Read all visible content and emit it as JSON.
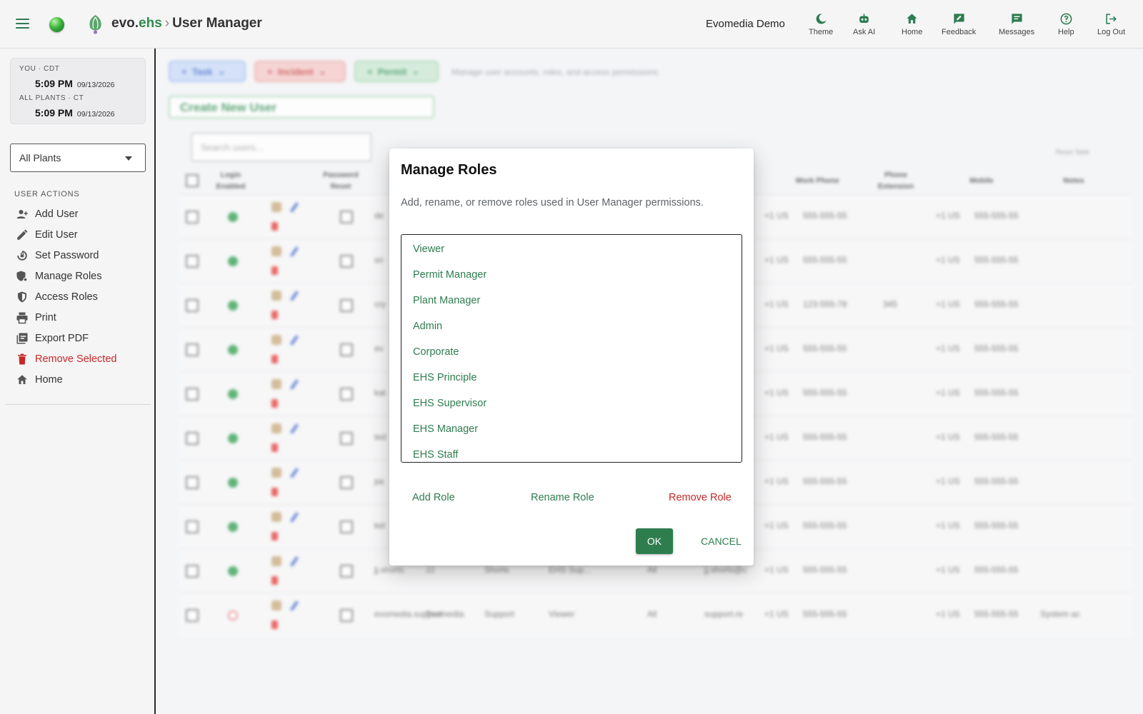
{
  "app": {
    "brand_prefix": "evo.",
    "brand_suffix": "ehs",
    "breadcrumb_sep": "›",
    "page_title": "User Manager",
    "org_name": "Evomedia Demo",
    "accent_color": "#2e7d4f",
    "danger_color": "#c62828"
  },
  "topnav": [
    {
      "label": "Theme",
      "icon": "moon-icon"
    },
    {
      "label": "Ask AI",
      "icon": "robot-icon"
    },
    {
      "label": "Home",
      "icon": "home-icon"
    },
    {
      "label": "Feedback",
      "icon": "feedback-icon"
    },
    {
      "label": "Messages",
      "icon": "message-icon"
    },
    {
      "label": "Help",
      "icon": "help-icon"
    },
    {
      "label": "Log Out",
      "icon": "logout-icon"
    }
  ],
  "clock": {
    "you_label": "YOU · CDT",
    "you_time": "5:09 PM",
    "you_date": "09/13/2026",
    "plants_label": "ALL PLANTS · CT",
    "plants_time": "5:09 PM",
    "plants_date": "09/13/2026"
  },
  "plant_select": {
    "value": "All Plants"
  },
  "sidebar": {
    "heading": "USER ACTIONS",
    "items": [
      {
        "label": "Add User",
        "icon": "add-user-icon"
      },
      {
        "label": "Edit User",
        "icon": "pencil-icon"
      },
      {
        "label": "Set Password",
        "icon": "password-reset-icon"
      },
      {
        "label": "Manage Roles",
        "icon": "manage-roles-icon"
      },
      {
        "label": "Access Roles",
        "icon": "shield-icon"
      },
      {
        "label": "Print",
        "icon": "printer-icon"
      },
      {
        "label": "Export PDF",
        "icon": "pdf-icon"
      },
      {
        "label": "Remove Selected",
        "icon": "trash-icon"
      },
      {
        "label": "Home",
        "icon": "home-icon"
      }
    ]
  },
  "background": {
    "task_label": "Task",
    "incident_label": "Incident",
    "permit_label": "Permit",
    "description": "Manage user accounts, roles, and access permissions.",
    "create_user": "Create New User",
    "search_placeholder": "Search users...",
    "reset_table": "Reset Table",
    "columns": {
      "login_enabled": "Login Enabled",
      "password_reset": "Password Reset",
      "work_phone": "Work Phone",
      "phone_extension": "Phone Extension",
      "mobile": "Mobile",
      "notes": "Notes"
    },
    "rows": [
      {
        "user": "de",
        "enabled": true,
        "work": "555-555-55",
        "ext": "",
        "mobile": "555-555-55",
        "notes": ""
      },
      {
        "user": "sn",
        "enabled": true,
        "work": "555-555-55",
        "ext": "",
        "mobile": "555-555-55",
        "notes": ""
      },
      {
        "user": "cry",
        "enabled": true,
        "work": "123-555-78",
        "ext": "345",
        "mobile": "555-555-55",
        "notes": ""
      },
      {
        "user": "ev",
        "enabled": true,
        "work": "555-555-55",
        "ext": "",
        "mobile": "555-555-55",
        "notes": ""
      },
      {
        "user": "kat",
        "enabled": true,
        "work": "555-555-55",
        "ext": "",
        "mobile": "555-555-55",
        "notes": ""
      },
      {
        "user": "ted",
        "enabled": true,
        "work": "555-555-55",
        "ext": "",
        "mobile": "555-555-55",
        "notes": ""
      },
      {
        "user": "pa",
        "enabled": true,
        "work": "555-555-55",
        "ext": "",
        "mobile": "555-555-55",
        "notes": ""
      },
      {
        "user": "kel",
        "enabled": true,
        "work": "555-555-55",
        "ext": "",
        "mobile": "555-555-55",
        "notes": ""
      },
      {
        "user": "jj.shorts",
        "first": "JJ",
        "last": "Shorts",
        "role": "EHS Sup...",
        "plant": "All",
        "email": "jj.shorts@c",
        "enabled": true,
        "work": "555-555-55",
        "ext": "",
        "mobile": "555-555-55",
        "notes": ""
      },
      {
        "user": "evomedia.support",
        "first": "Evomedia",
        "last": "Support",
        "role": "Viewer",
        "plant": "All",
        "email": "support.re",
        "enabled": false,
        "work": "555-555-55",
        "ext": "",
        "mobile": "555-555-55",
        "notes": "System ac"
      }
    ],
    "country_code": "+1 US"
  },
  "dialog": {
    "title": "Manage Roles",
    "description": "Add, rename, or remove roles used in User Manager permissions.",
    "roles": [
      "Viewer",
      "Permit Manager",
      "Plant Manager",
      "Admin",
      "Corporate",
      "EHS Principle",
      "EHS Supervisor",
      "EHS Manager",
      "EHS Staff"
    ],
    "add_role": "Add Role",
    "rename_role": "Rename Role",
    "remove_role": "Remove Role",
    "ok": "OK",
    "cancel": "CANCEL"
  }
}
